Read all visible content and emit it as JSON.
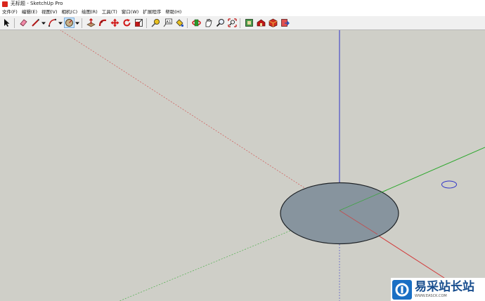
{
  "window": {
    "title": "无标题 - SketchUp Pro"
  },
  "menu": {
    "items": [
      "文件(F)",
      "编辑(E)",
      "视图(V)",
      "相机(C)",
      "绘图(R)",
      "工具(T)",
      "窗口(W)",
      "扩展程序",
      "帮助(H)"
    ]
  },
  "toolbar": {
    "tools": [
      "select",
      "eraser",
      "pencil-line",
      "arc",
      "shape-circle",
      "push-pull",
      "follow-me",
      "move",
      "rotate",
      "scale",
      "tape-measure",
      "text",
      "paint-bucket",
      "orbit",
      "pan",
      "zoom",
      "zoom-extents",
      "components",
      "warehouse",
      "extension-warehouse",
      "send-to-layout"
    ],
    "active_tool": "shape-circle"
  },
  "viewport": {
    "axis_colors": {
      "red": "#d23a3a",
      "green": "#2ea82e",
      "blue": "#2f33c8"
    },
    "disk_fill": "#87949e",
    "disk_stroke": "#1e2226"
  },
  "watermark": {
    "name": "易采站长站",
    "url": "WWW.EASCK.COM"
  }
}
